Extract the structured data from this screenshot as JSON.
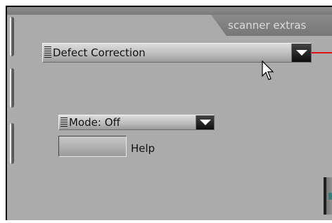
{
  "tab": {
    "label": "scanner extras"
  },
  "defect_dropdown": {
    "selected": "Defect Correction"
  },
  "mode_dropdown": {
    "selected": "Mode: Off"
  },
  "help": {
    "label": "Help"
  },
  "colors": {
    "panel": "#ababab",
    "callout_line": "#e01010",
    "tab": "#808080"
  }
}
